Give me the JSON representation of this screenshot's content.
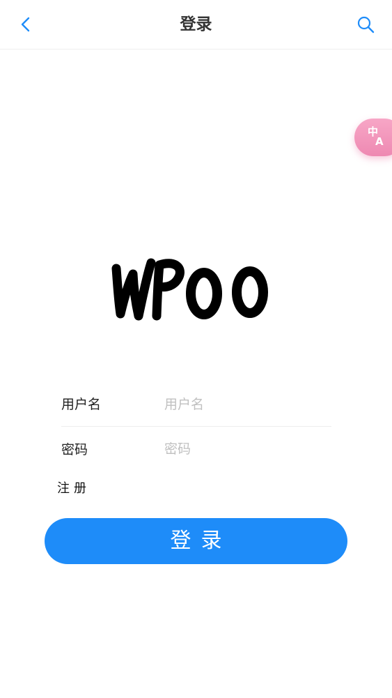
{
  "header": {
    "title": "登录",
    "back_icon": "chevron-left-icon",
    "search_icon": "search-icon"
  },
  "translate_button": {
    "icon": "translate-icon",
    "glyph_top": "中",
    "glyph_bottom": "A"
  },
  "logo": {
    "text": "WPoo"
  },
  "form": {
    "username": {
      "label": "用户名",
      "placeholder": "用户名",
      "value": ""
    },
    "password": {
      "label": "密码",
      "placeholder": "密码",
      "value": ""
    }
  },
  "register_label": "注册",
  "login_button_label": "登录",
  "colors": {
    "accent": "#1e8cf9",
    "translate_bg": "#f2a0c2"
  }
}
